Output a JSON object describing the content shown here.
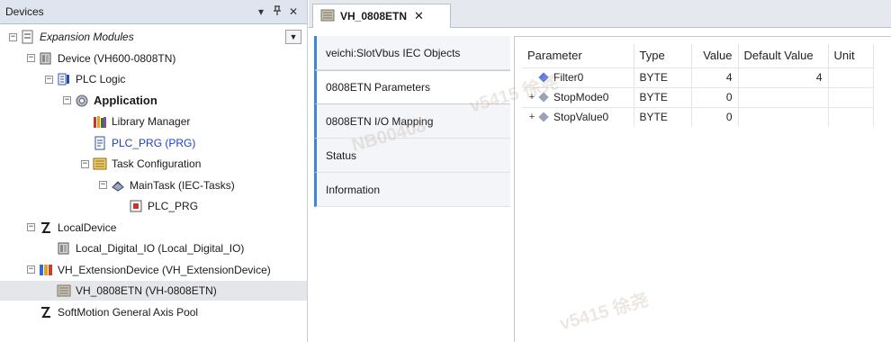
{
  "devices_panel": {
    "title": "Devices",
    "pin_glyph": "▾",
    "pin2_glyph": "ᵠ",
    "close_glyph": "✕"
  },
  "tree": [
    {
      "label": "Expansion Modules",
      "style": "italic",
      "icon": "project-icon",
      "level": 0,
      "expanded": true
    },
    {
      "label": "Device (VH600-0808TN)",
      "style": "normal",
      "icon": "device-icon",
      "level": 1,
      "expanded": true
    },
    {
      "label": "PLC Logic",
      "style": "normal",
      "icon": "plc-logic-icon",
      "level": 2,
      "expanded": true
    },
    {
      "label": "Application",
      "style": "bold",
      "icon": "application-gear-icon",
      "level": 3,
      "expanded": true
    },
    {
      "label": "Library Manager",
      "style": "normal",
      "icon": "library-manager-icon",
      "level": 4,
      "expanded": null
    },
    {
      "label": "PLC_PRG (PRG)",
      "style": "blue",
      "icon": "program-icon",
      "level": 4,
      "expanded": null
    },
    {
      "label": "Task Configuration",
      "style": "normal",
      "icon": "task-configuration-icon",
      "level": 4,
      "expanded": true
    },
    {
      "label": "MainTask (IEC-Tasks)",
      "style": "normal",
      "icon": "main-task-icon",
      "level": 5,
      "expanded": true
    },
    {
      "label": "PLC_PRG",
      "style": "normal",
      "icon": "program-call-icon",
      "level": 6,
      "expanded": null
    },
    {
      "label": "LocalDevice",
      "style": "normal",
      "icon": "local-device-icon",
      "level": 1,
      "expanded": true
    },
    {
      "label": "Local_Digital_IO (Local_Digital_IO)",
      "style": "normal",
      "icon": "digital-io-icon",
      "level": 2,
      "expanded": null
    },
    {
      "label": "VH_ExtensionDevice (VH_ExtensionDevice)",
      "style": "normal",
      "icon": "extension-device-icon",
      "level": 1,
      "expanded": true
    },
    {
      "label": "VH_0808ETN (VH-0808ETN)",
      "style": "normal",
      "icon": "module-icon",
      "level": 2,
      "expanded": null,
      "selected": true
    },
    {
      "label": "SoftMotion General Axis Pool",
      "style": "normal",
      "icon": "axis-pool-icon",
      "level": 1,
      "expanded": null
    }
  ],
  "editor": {
    "tab_label": "VH_0808ETN",
    "tab_close": "✕",
    "side_tabs": [
      {
        "label": "veichi:SlotVbus IEC Objects",
        "active": false
      },
      {
        "label": "0808ETN Parameters",
        "active": true
      },
      {
        "label": "0808ETN I/O Mapping",
        "active": false
      },
      {
        "label": "Status",
        "active": false
      },
      {
        "label": "Information",
        "active": false
      }
    ],
    "table": {
      "headers": [
        "Parameter",
        "Type",
        "Value",
        "Default Value",
        "Unit"
      ],
      "rows": [
        {
          "expander": "",
          "name": "Filter0",
          "type": "BYTE",
          "value": "4",
          "default": "4",
          "unit": "",
          "diamond_color": "#5b7bd6"
        },
        {
          "expander": "+",
          "name": "StopMode0",
          "type": "BYTE",
          "value": "0",
          "default": "",
          "unit": "",
          "diamond_color": "#9aa3b5"
        },
        {
          "expander": "+",
          "name": "StopValue0",
          "type": "BYTE",
          "value": "0",
          "default": "",
          "unit": "",
          "diamond_color": "#9aa3b5"
        }
      ]
    }
  },
  "colors": {
    "accent_blue": "#3d86d6",
    "link_blue": "#1d3fc4",
    "header_bg": "#dfe5ee"
  }
}
